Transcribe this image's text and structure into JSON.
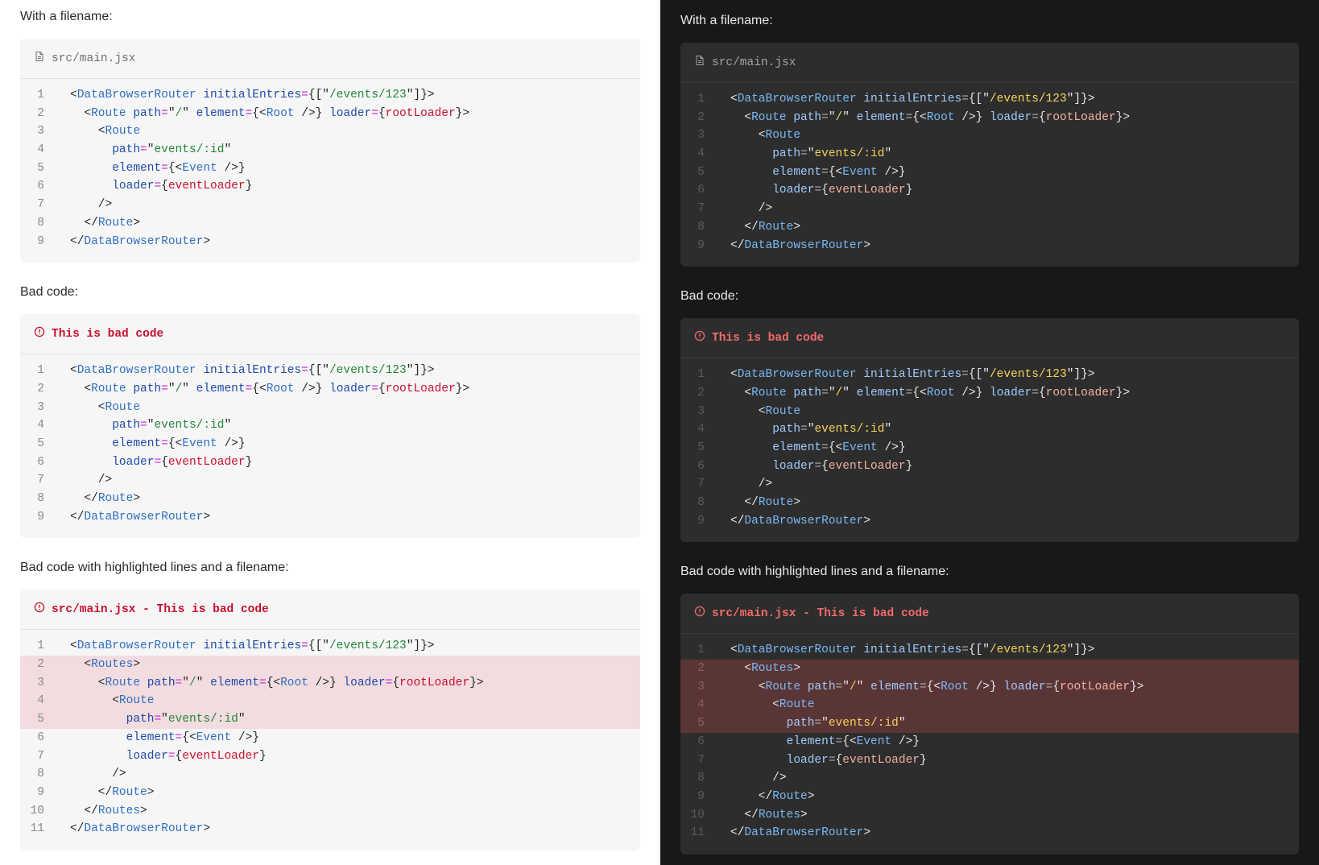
{
  "sections": [
    {
      "heading": "With a filename:",
      "header": "src/main.jsx",
      "header_kind": "file",
      "header_icon": "file-icon",
      "highlight": [],
      "lines": [
        [
          [
            "p",
            "<"
          ],
          [
            "tag",
            "DataBrowserRouter"
          ],
          [
            "p",
            " "
          ],
          [
            "attr",
            "initialEntries"
          ],
          [
            "eq",
            "="
          ],
          [
            "p",
            "{[\""
          ],
          [
            "str",
            "/events/123"
          ],
          [
            "p",
            "\"]}>"
          ]
        ],
        [
          [
            "p",
            "  <"
          ],
          [
            "tag",
            "Route"
          ],
          [
            "p",
            " "
          ],
          [
            "attr",
            "path"
          ],
          [
            "eq",
            "="
          ],
          [
            "p",
            "\""
          ],
          [
            "str",
            "/"
          ],
          [
            "p",
            "\" "
          ],
          [
            "attr",
            "element"
          ],
          [
            "eq",
            "="
          ],
          [
            "p",
            "{<"
          ],
          [
            "tag",
            "Root"
          ],
          [
            "p",
            " />} "
          ],
          [
            "attr",
            "loader"
          ],
          [
            "eq",
            "="
          ],
          [
            "p",
            "{"
          ],
          [
            "var",
            "rootLoader"
          ],
          [
            "p",
            "}>"
          ]
        ],
        [
          [
            "p",
            "    <"
          ],
          [
            "tag",
            "Route"
          ]
        ],
        [
          [
            "p",
            "      "
          ],
          [
            "attr",
            "path"
          ],
          [
            "eq",
            "="
          ],
          [
            "p",
            "\""
          ],
          [
            "str",
            "events/:id"
          ],
          [
            "p",
            "\""
          ]
        ],
        [
          [
            "p",
            "      "
          ],
          [
            "attr",
            "element"
          ],
          [
            "eq",
            "="
          ],
          [
            "p",
            "{<"
          ],
          [
            "tag",
            "Event"
          ],
          [
            "p",
            " />}"
          ]
        ],
        [
          [
            "p",
            "      "
          ],
          [
            "attr",
            "loader"
          ],
          [
            "eq",
            "="
          ],
          [
            "p",
            "{"
          ],
          [
            "var",
            "eventLoader"
          ],
          [
            "p",
            "}"
          ]
        ],
        [
          [
            "p",
            "    />"
          ]
        ],
        [
          [
            "p",
            "  </"
          ],
          [
            "tag",
            "Route"
          ],
          [
            "p",
            ">"
          ]
        ],
        [
          [
            "p",
            "</"
          ],
          [
            "tag",
            "DataBrowserRouter"
          ],
          [
            "p",
            ">"
          ]
        ]
      ]
    },
    {
      "heading": "Bad code:",
      "header": "This is bad code",
      "header_kind": "bad",
      "header_icon": "alert-circle-icon",
      "highlight": [],
      "lines": [
        [
          [
            "p",
            "<"
          ],
          [
            "tag",
            "DataBrowserRouter"
          ],
          [
            "p",
            " "
          ],
          [
            "attr",
            "initialEntries"
          ],
          [
            "eq",
            "="
          ],
          [
            "p",
            "{[\""
          ],
          [
            "str",
            "/events/123"
          ],
          [
            "p",
            "\"]}>"
          ]
        ],
        [
          [
            "p",
            "  <"
          ],
          [
            "tag",
            "Route"
          ],
          [
            "p",
            " "
          ],
          [
            "attr",
            "path"
          ],
          [
            "eq",
            "="
          ],
          [
            "p",
            "\""
          ],
          [
            "str",
            "/"
          ],
          [
            "p",
            "\" "
          ],
          [
            "attr",
            "element"
          ],
          [
            "eq",
            "="
          ],
          [
            "p",
            "{<"
          ],
          [
            "tag",
            "Root"
          ],
          [
            "p",
            " />} "
          ],
          [
            "attr",
            "loader"
          ],
          [
            "eq",
            "="
          ],
          [
            "p",
            "{"
          ],
          [
            "var",
            "rootLoader"
          ],
          [
            "p",
            "}>"
          ]
        ],
        [
          [
            "p",
            "    <"
          ],
          [
            "tag",
            "Route"
          ]
        ],
        [
          [
            "p",
            "      "
          ],
          [
            "attr",
            "path"
          ],
          [
            "eq",
            "="
          ],
          [
            "p",
            "\""
          ],
          [
            "str",
            "events/:id"
          ],
          [
            "p",
            "\""
          ]
        ],
        [
          [
            "p",
            "      "
          ],
          [
            "attr",
            "element"
          ],
          [
            "eq",
            "="
          ],
          [
            "p",
            "{<"
          ],
          [
            "tag",
            "Event"
          ],
          [
            "p",
            " />}"
          ]
        ],
        [
          [
            "p",
            "      "
          ],
          [
            "attr",
            "loader"
          ],
          [
            "eq",
            "="
          ],
          [
            "p",
            "{"
          ],
          [
            "var",
            "eventLoader"
          ],
          [
            "p",
            "}"
          ]
        ],
        [
          [
            "p",
            "    />"
          ]
        ],
        [
          [
            "p",
            "  </"
          ],
          [
            "tag",
            "Route"
          ],
          [
            "p",
            ">"
          ]
        ],
        [
          [
            "p",
            "</"
          ],
          [
            "tag",
            "DataBrowserRouter"
          ],
          [
            "p",
            ">"
          ]
        ]
      ]
    },
    {
      "heading": "Bad code with highlighted lines and a filename:",
      "header": "src/main.jsx - This is bad code",
      "header_kind": "bad",
      "header_icon": "alert-circle-icon",
      "highlight": [
        2,
        3,
        4,
        5
      ],
      "lines": [
        [
          [
            "p",
            "<"
          ],
          [
            "tag",
            "DataBrowserRouter"
          ],
          [
            "p",
            " "
          ],
          [
            "attr",
            "initialEntries"
          ],
          [
            "eq",
            "="
          ],
          [
            "p",
            "{[\""
          ],
          [
            "str",
            "/events/123"
          ],
          [
            "p",
            "\"]}>"
          ]
        ],
        [
          [
            "p",
            "  <"
          ],
          [
            "tag",
            "Routes"
          ],
          [
            "p",
            ">"
          ]
        ],
        [
          [
            "p",
            "    <"
          ],
          [
            "tag",
            "Route"
          ],
          [
            "p",
            " "
          ],
          [
            "attr",
            "path"
          ],
          [
            "eq",
            "="
          ],
          [
            "p",
            "\""
          ],
          [
            "str",
            "/"
          ],
          [
            "p",
            "\" "
          ],
          [
            "attr",
            "element"
          ],
          [
            "eq",
            "="
          ],
          [
            "p",
            "{<"
          ],
          [
            "tag",
            "Root"
          ],
          [
            "p",
            " />} "
          ],
          [
            "attr",
            "loader"
          ],
          [
            "eq",
            "="
          ],
          [
            "p",
            "{"
          ],
          [
            "var",
            "rootLoader"
          ],
          [
            "p",
            "}>"
          ]
        ],
        [
          [
            "p",
            "      <"
          ],
          [
            "tag",
            "Route"
          ]
        ],
        [
          [
            "p",
            "        "
          ],
          [
            "attr",
            "path"
          ],
          [
            "eq",
            "="
          ],
          [
            "p",
            "\""
          ],
          [
            "str",
            "events/:id"
          ],
          [
            "p",
            "\""
          ]
        ],
        [
          [
            "p",
            "        "
          ],
          [
            "attr",
            "element"
          ],
          [
            "eq",
            "="
          ],
          [
            "p",
            "{<"
          ],
          [
            "tag",
            "Event"
          ],
          [
            "p",
            " />}"
          ]
        ],
        [
          [
            "p",
            "        "
          ],
          [
            "attr",
            "loader"
          ],
          [
            "eq",
            "="
          ],
          [
            "p",
            "{"
          ],
          [
            "var",
            "eventLoader"
          ],
          [
            "p",
            "}"
          ]
        ],
        [
          [
            "p",
            "      />"
          ]
        ],
        [
          [
            "p",
            "    </"
          ],
          [
            "tag",
            "Route"
          ],
          [
            "p",
            ">"
          ]
        ],
        [
          [
            "p",
            "  </"
          ],
          [
            "tag",
            "Routes"
          ],
          [
            "p",
            ">"
          ]
        ],
        [
          [
            "p",
            "</"
          ],
          [
            "tag",
            "DataBrowserRouter"
          ],
          [
            "p",
            ">"
          ]
        ]
      ]
    }
  ]
}
